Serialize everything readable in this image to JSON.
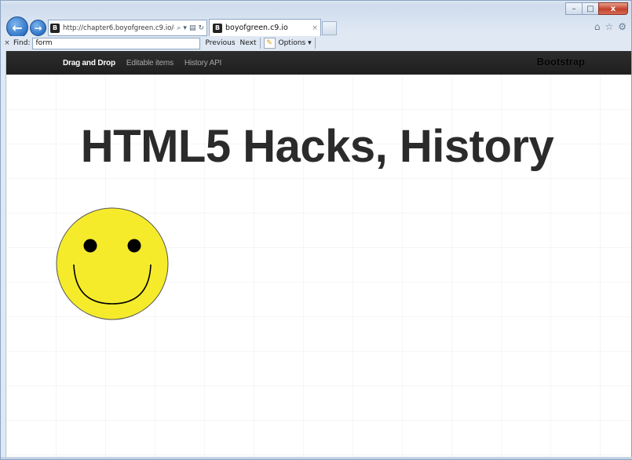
{
  "browser": {
    "url": "http://chapter6.boyofgreen.c9.io/ex",
    "tab_title": "boyofgreen.c9.io",
    "tab_close": "×",
    "favicon_letter": "B",
    "window_controls": {
      "minimize": "–",
      "maximize": "□",
      "close": "x"
    }
  },
  "find_bar": {
    "close": "×",
    "label": "Find:",
    "value": "form",
    "previous": "Previous",
    "next": "Next",
    "options": "Options ▾"
  },
  "navbar": {
    "items": [
      "Drag and Drop",
      "Editable items",
      "History API"
    ],
    "active_index": 0,
    "brand": "Bootstrap"
  },
  "page": {
    "heading": "HTML5 Hacks, History"
  },
  "smiley": {
    "icon": "smiley-face",
    "face_color": "#f5eb2a",
    "feature_color": "#000000"
  }
}
